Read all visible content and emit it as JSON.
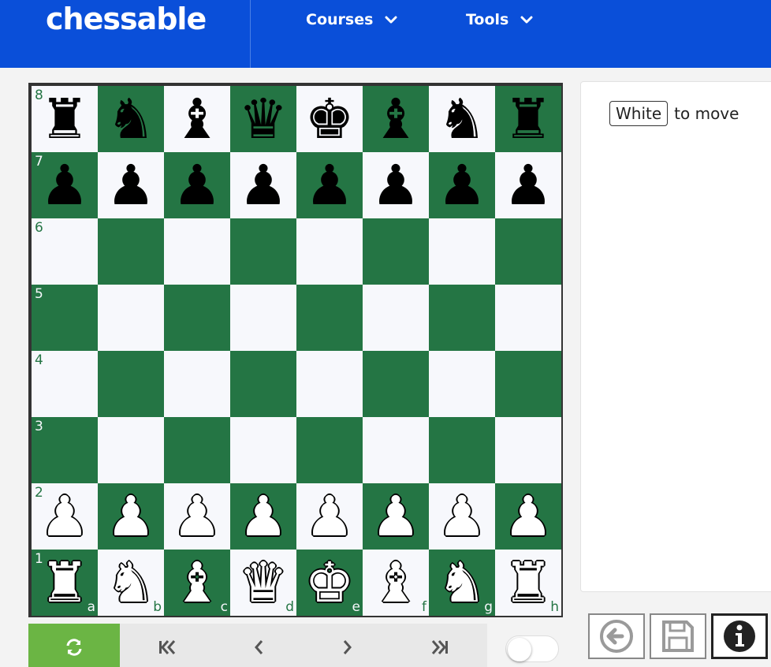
{
  "header": {
    "logo": "chessable",
    "nav": [
      {
        "label": "Courses",
        "icon": "chevron-down-icon"
      },
      {
        "label": "Tools",
        "icon": "chevron-down-icon"
      }
    ]
  },
  "board": {
    "files": [
      "a",
      "b",
      "c",
      "d",
      "e",
      "f",
      "g",
      "h"
    ],
    "ranks": [
      "8",
      "7",
      "6",
      "5",
      "4",
      "3",
      "2",
      "1"
    ],
    "colors": {
      "light": "#f7f8fc",
      "dark": "#247544"
    },
    "position": [
      [
        "r",
        "n",
        "b",
        "q",
        "k",
        "b",
        "n",
        "r"
      ],
      [
        "p",
        "p",
        "p",
        "p",
        "p",
        "p",
        "p",
        "p"
      ],
      [
        "",
        "",
        "",
        "",
        "",
        "",
        "",
        ""
      ],
      [
        "",
        "",
        "",
        "",
        "",
        "",
        "",
        ""
      ],
      [
        "",
        "",
        "",
        "",
        "",
        "",
        "",
        ""
      ],
      [
        "",
        "",
        "",
        "",
        "",
        "",
        "",
        ""
      ],
      [
        "P",
        "P",
        "P",
        "P",
        "P",
        "P",
        "P",
        "P"
      ],
      [
        "R",
        "N",
        "B",
        "Q",
        "K",
        "B",
        "N",
        "R"
      ]
    ]
  },
  "panel": {
    "side": "White",
    "to_move": "to move"
  },
  "controls": {
    "icons": [
      "flip-board-icon",
      "first-move-icon",
      "previous-move-icon",
      "next-move-icon",
      "last-move-icon"
    ],
    "accent": "#6bb544"
  },
  "tools": {
    "icons": [
      "back-arrow-icon",
      "save-icon",
      "info-icon"
    ]
  },
  "brand_color": "#0a4fd9"
}
